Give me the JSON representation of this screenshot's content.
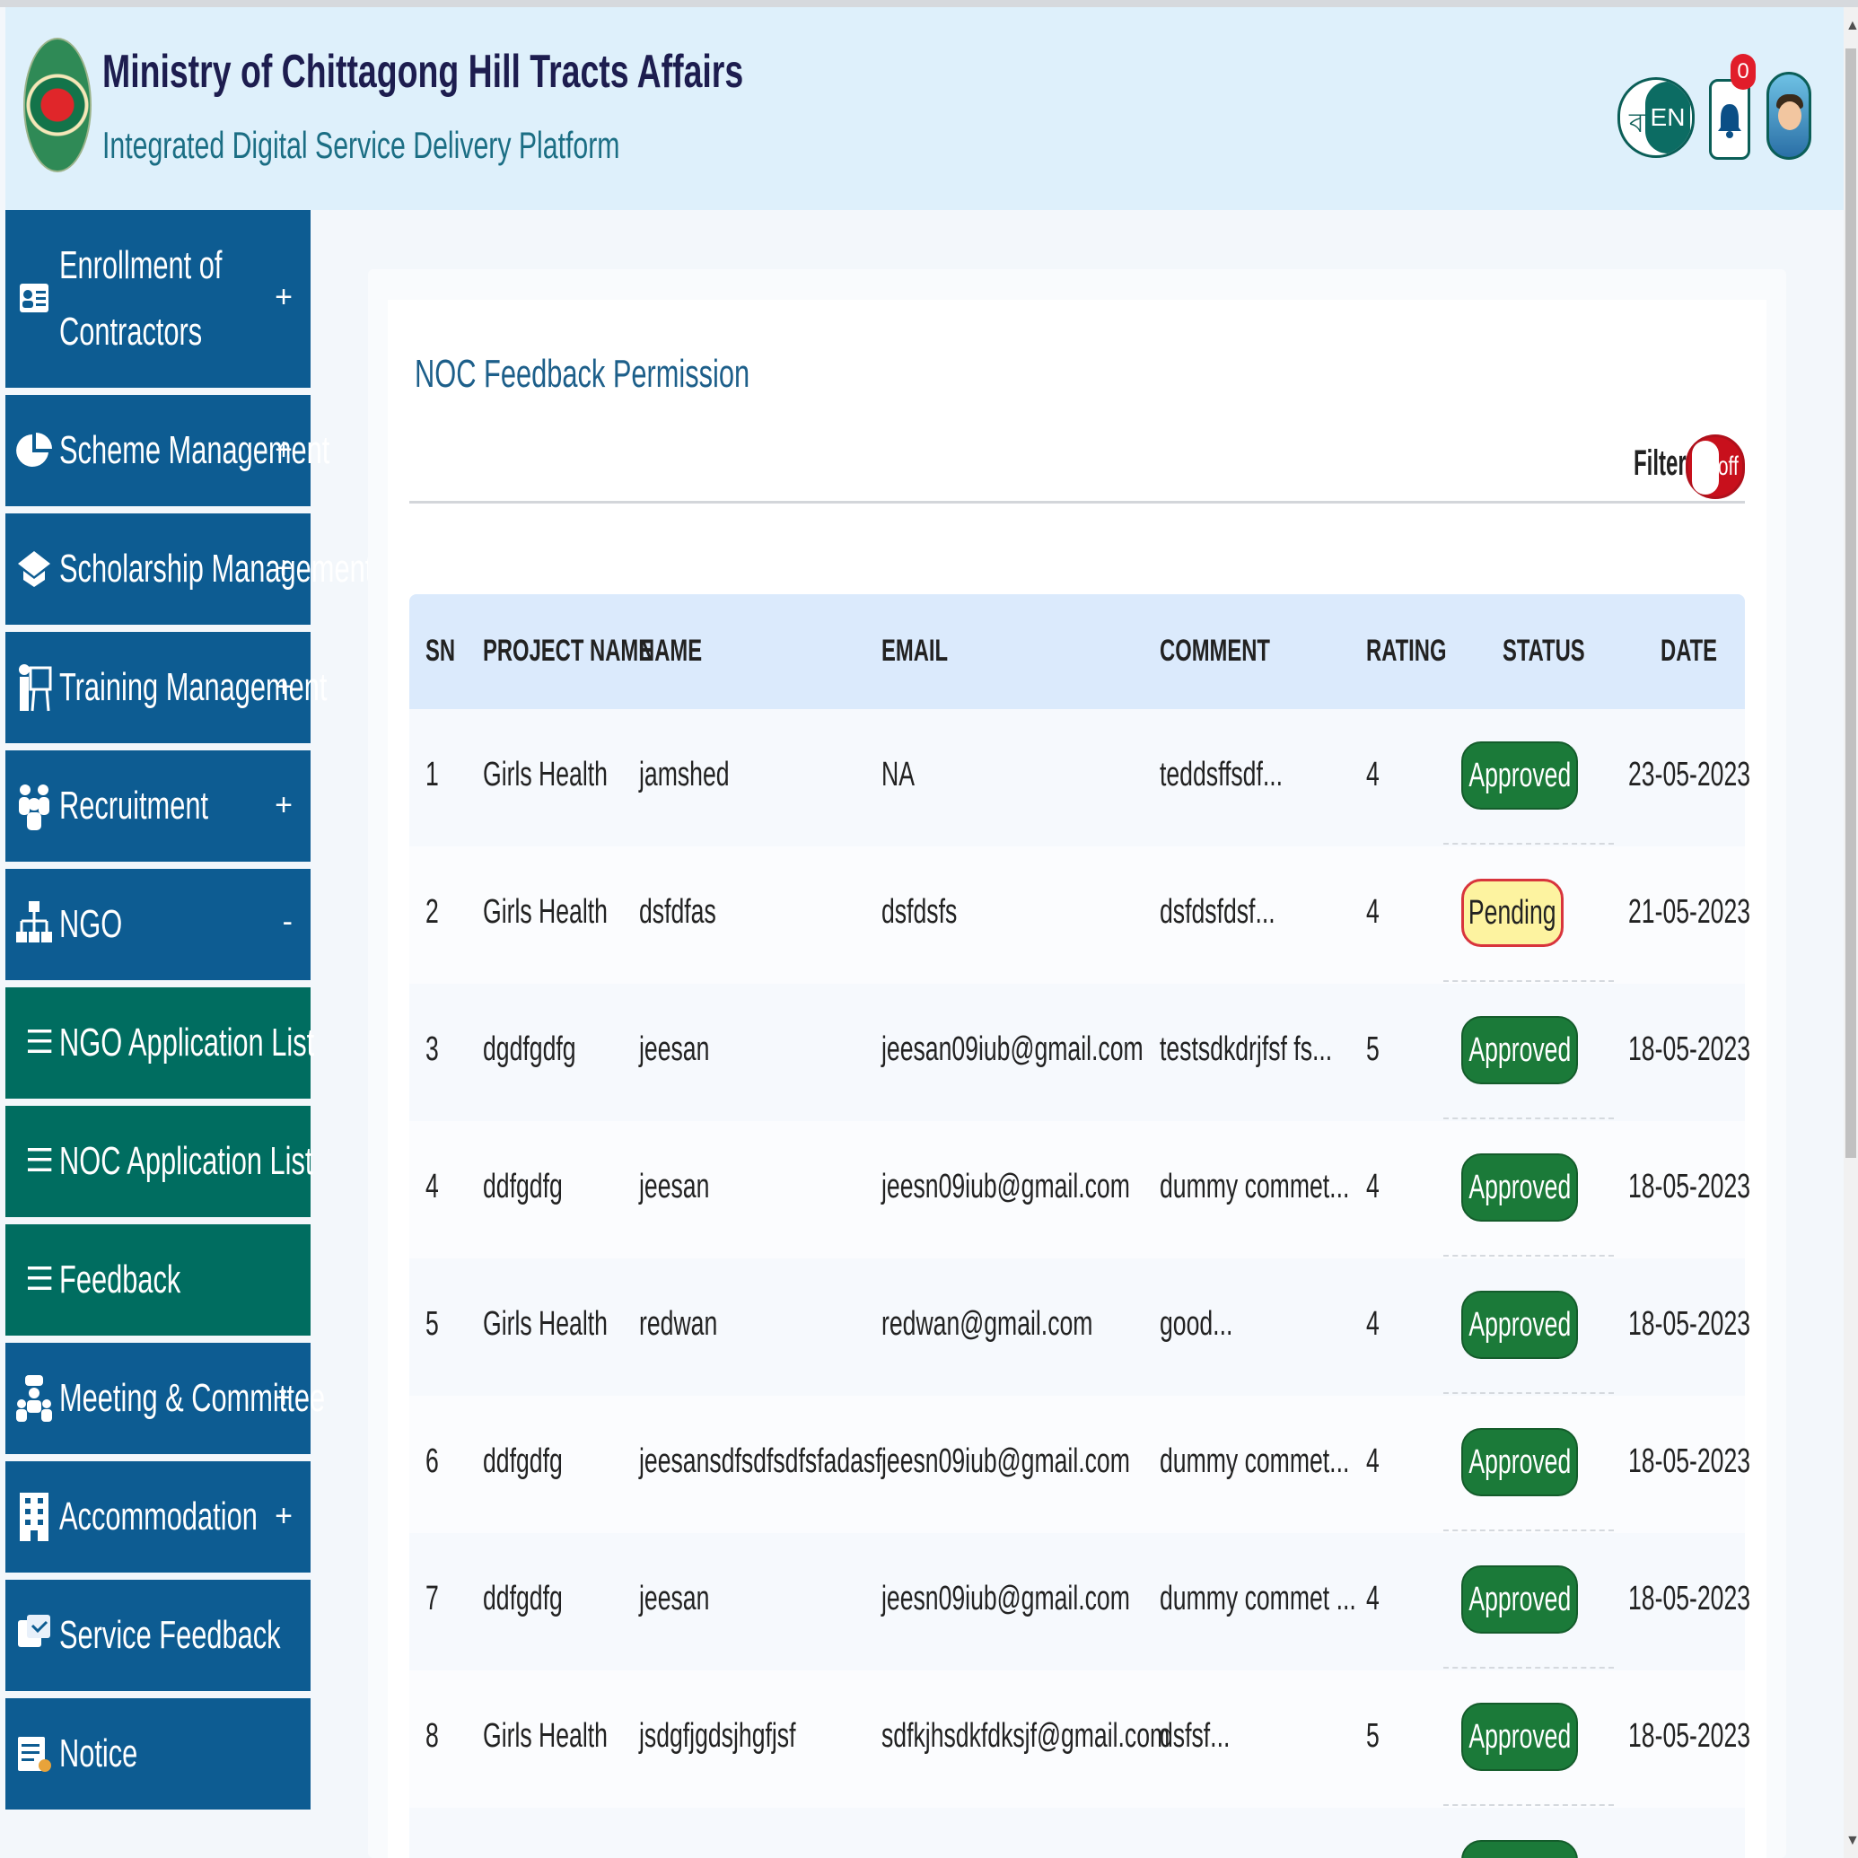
{
  "header": {
    "title": "Ministry of Chittagong Hill Tracts Affairs",
    "subtitle": "Integrated Digital Service Delivery Platform",
    "lang_bn": "বাং",
    "lang_en": "EN",
    "notification_count": "0"
  },
  "sidebar": {
    "items": [
      {
        "label_line1": "Enrollment of",
        "label_line2": "Contractors",
        "sign": "+",
        "icon": "contact-card-icon"
      },
      {
        "label": "Scheme Management",
        "sign": "+",
        "icon": "pie-chart-icon"
      },
      {
        "label": "Scholarship Management",
        "sign": "+",
        "icon": "graduation-icon"
      },
      {
        "label": "Training Management",
        "sign": "+",
        "icon": "trainer-icon"
      },
      {
        "label": "Recruitment",
        "sign": "+",
        "icon": "people-icon"
      },
      {
        "label": "NGO",
        "sign": "-",
        "icon": "org-chart-icon"
      },
      {
        "label": "NGO Application List",
        "icon": "list-icon"
      },
      {
        "label": "NOC Application List",
        "icon": "list-icon"
      },
      {
        "label": "Feedback",
        "icon": "list-icon"
      },
      {
        "label": "Meeting & Committee",
        "sign": "+",
        "icon": "meeting-icon"
      },
      {
        "label": "Accommodation",
        "sign": "+",
        "icon": "building-icon"
      },
      {
        "label": "Service Feedback",
        "icon": "feedback-icon"
      },
      {
        "label": "Notice",
        "icon": "notice-icon"
      }
    ]
  },
  "main": {
    "title": "NOC Feedback Permission",
    "filter_label": "Filter",
    "filter_state": "off"
  },
  "table": {
    "columns": [
      "SN",
      "PROJECT NAME",
      "NAME",
      "EMAIL",
      "COMMENT",
      "RATING",
      "STATUS",
      "DATE"
    ],
    "rows": [
      {
        "sn": "1",
        "project": "Girls Health",
        "name": "jamshed",
        "email": "NA",
        "comment": "teddsffsdf...",
        "rating": "4",
        "status": "Approved",
        "date": "23-05-2023"
      },
      {
        "sn": "2",
        "project": "Girls Health",
        "name": "dsfdfas",
        "email": "dsfdsfs",
        "comment": "dsfdsfdsf...",
        "rating": "4",
        "status": "Pending",
        "date": "21-05-2023"
      },
      {
        "sn": "3",
        "project": "dgdfgdfg",
        "name": "jeesan",
        "email": "jeesan09iub@gmail.com",
        "comment": "testsdkdrjfsf fs...",
        "rating": "5",
        "status": "Approved",
        "date": "18-05-2023"
      },
      {
        "sn": "4",
        "project": "ddfgdfg",
        "name": "jeesan",
        "email": "jeesn09iub@gmail.com",
        "comment": "dummy commet...",
        "rating": "4",
        "status": "Approved",
        "date": "18-05-2023"
      },
      {
        "sn": "5",
        "project": "Girls Health",
        "name": "redwan",
        "email": "redwan@gmail.com",
        "comment": "good...",
        "rating": "4",
        "status": "Approved",
        "date": "18-05-2023"
      },
      {
        "sn": "6",
        "project": "ddfgdfg",
        "name": "jeesansdfsdfsdfsfadasf",
        "email": "jeesn09iub@gmail.com",
        "comment": "dummy commet...",
        "rating": "4",
        "status": "Approved",
        "date": "18-05-2023"
      },
      {
        "sn": "7",
        "project": "ddfgdfg",
        "name": "jeesan",
        "email": "jeesn09iub@gmail.com",
        "comment": "dummy commet ...",
        "rating": "4",
        "status": "Approved",
        "date": "18-05-2023"
      },
      {
        "sn": "8",
        "project": "Girls Health",
        "name": "jsdgfjgdsjhgfjsf",
        "email": "sdfkjhsdkfdksjf@gmail.com",
        "comment": "dsfsf...",
        "rating": "5",
        "status": "Approved",
        "date": "18-05-2023"
      }
    ]
  },
  "colors": {
    "header_bg": "#def0fb",
    "nav_blue": "#0d5c92",
    "nav_teal": "#006d60",
    "approved": "#1b7a39",
    "pending_bg": "#fdf3a0",
    "pending_border": "#d8343c"
  }
}
